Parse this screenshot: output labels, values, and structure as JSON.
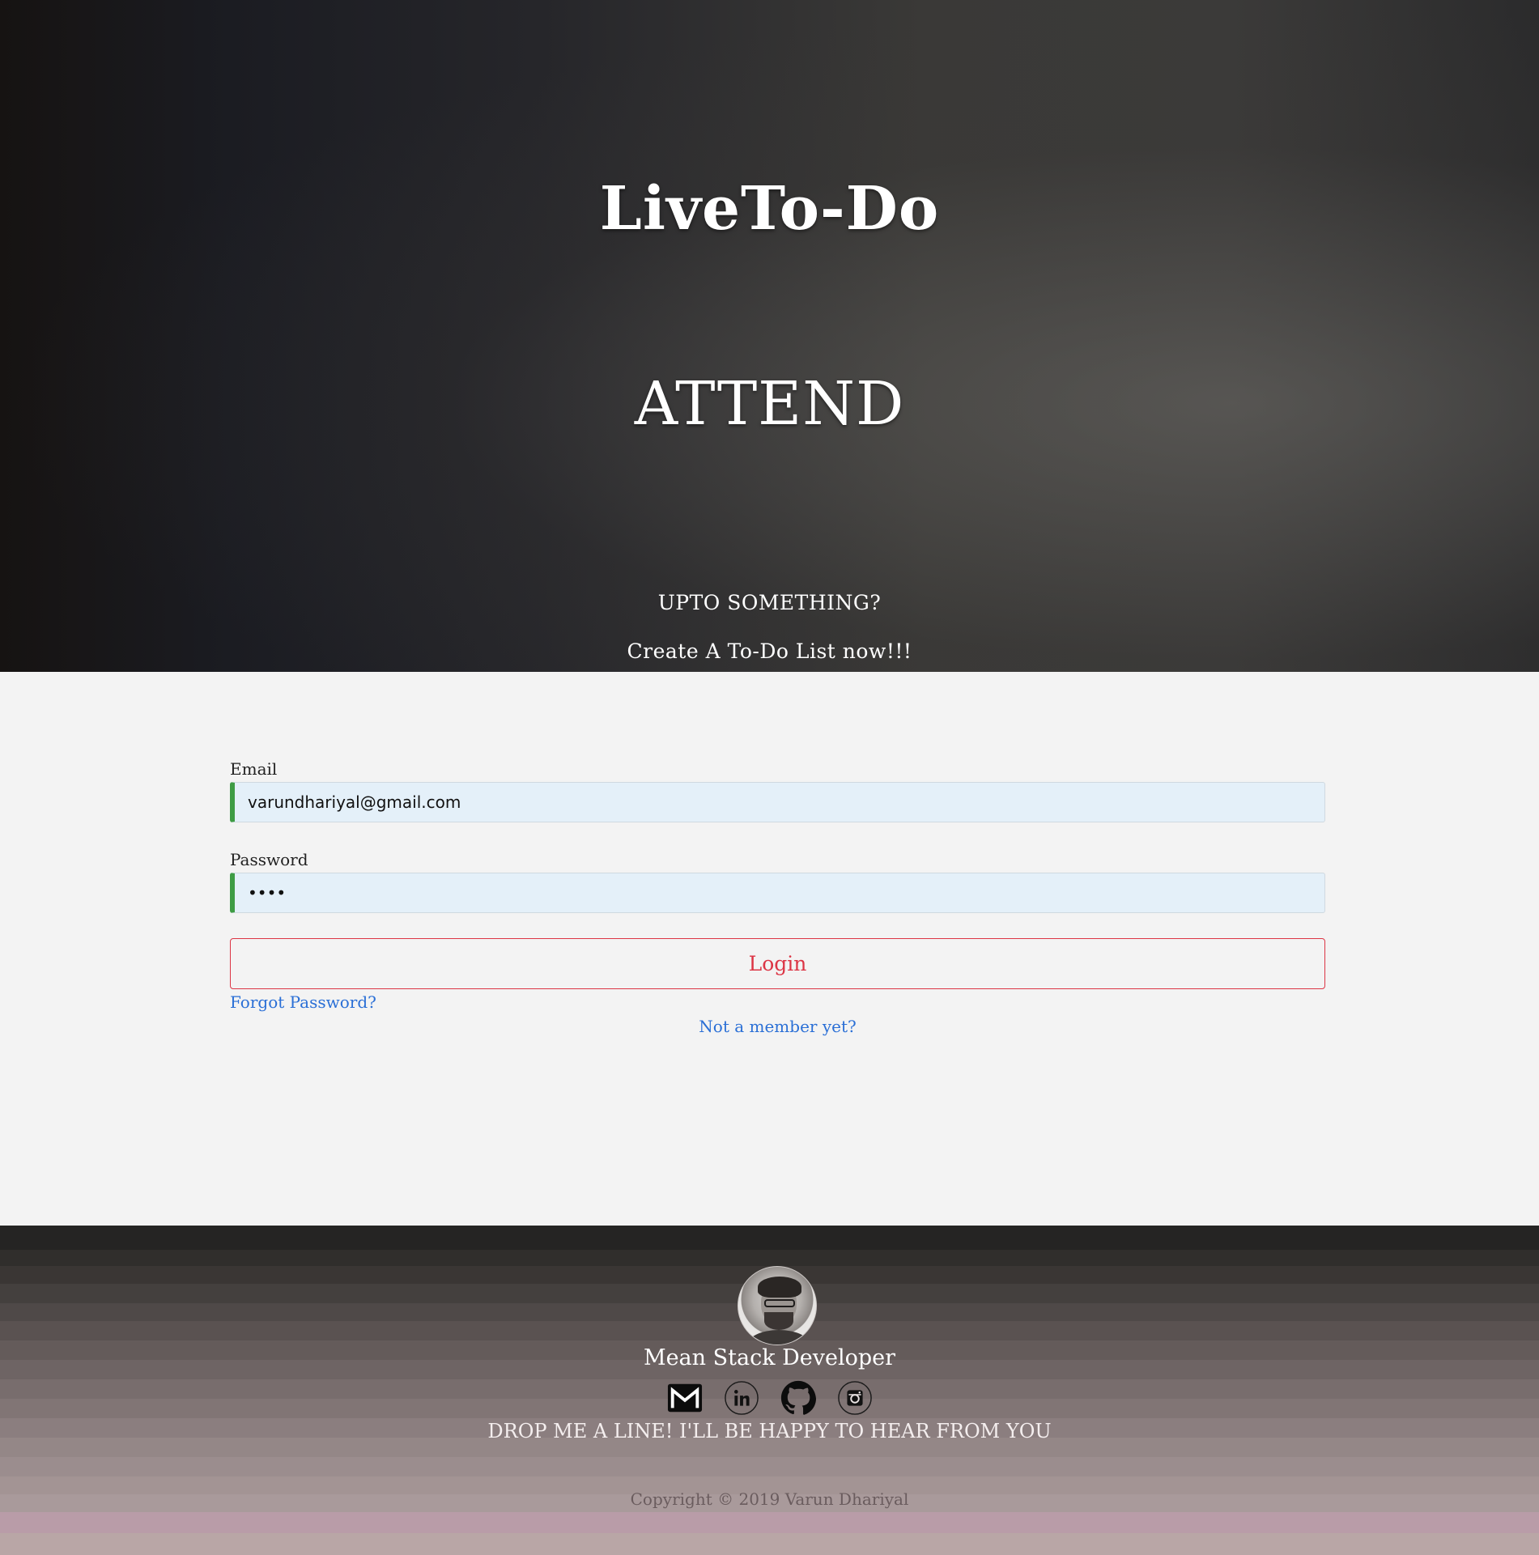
{
  "hero": {
    "title": "LiveTo-Do",
    "rotating_word": "ATTEND",
    "tagline": "UPTO SOMETHING?",
    "cta": "Create A To-Do List now!!!"
  },
  "login": {
    "email_label": "Email",
    "email_value": "varundhariyal@gmail.com",
    "password_label": "Password",
    "password_value": "••••",
    "login_button": "Login",
    "forgot_link": "Forgot Password?",
    "signup_link": "Not a member yet?"
  },
  "footer": {
    "role": "Mean Stack Developer",
    "socials": [
      {
        "icon": "gmail-icon"
      },
      {
        "icon": "linkedin-icon"
      },
      {
        "icon": "github-icon"
      },
      {
        "icon": "instagram-icon"
      }
    ],
    "contact_line": "DROP ME A LINE! I'LL BE HAPPY TO HEAR FROM YOU",
    "copyright": "Copyright © 2019 Varun Dhariyal"
  },
  "colors": {
    "input_bg": "#e4f0f9",
    "input_accent": "#3e9c44",
    "login_red": "#dc3545",
    "link_blue": "#2a6fd6"
  }
}
